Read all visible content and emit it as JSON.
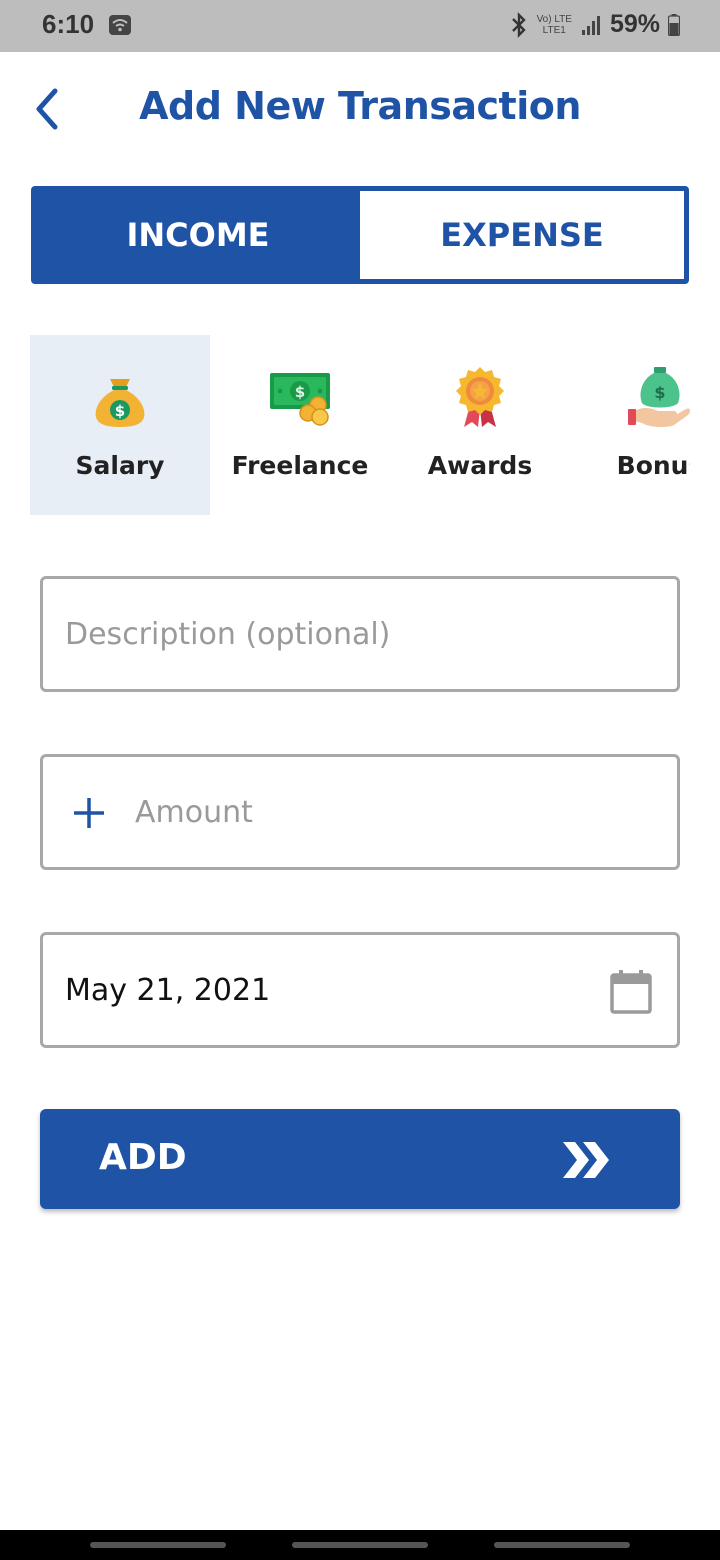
{
  "status_bar": {
    "time": "6:10",
    "net_top": "Vo) LTE",
    "net_bottom": "LTE1",
    "battery": "59%"
  },
  "header": {
    "title": "Add New Transaction",
    "back_icon": "chevron-left-icon"
  },
  "tabs": [
    {
      "label": "INCOME",
      "active": true
    },
    {
      "label": "EXPENSE",
      "active": false
    }
  ],
  "categories": [
    {
      "label": "Salary",
      "icon": "money-bag-icon",
      "selected": true
    },
    {
      "label": "Freelance",
      "icon": "cash-coins-icon",
      "selected": false
    },
    {
      "label": "Awards",
      "icon": "award-medal-icon",
      "selected": false
    },
    {
      "label": "Bonus",
      "icon": "hand-money-bag-icon",
      "selected": false
    }
  ],
  "form": {
    "description_placeholder": "Description (optional)",
    "description_value": "",
    "amount_placeholder": "Amount",
    "amount_value": "",
    "amount_sign": "plus-icon",
    "date_value": "May 21, 2021",
    "date_icon": "calendar-icon"
  },
  "add_button": {
    "label": "ADD",
    "icon": "double-chevron-right-icon"
  },
  "colors": {
    "primary": "#1f53a6",
    "selected_bg": "#e8eef6",
    "field_border": "#a8a8a8",
    "status_bar_bg": "#bdbdbd"
  }
}
